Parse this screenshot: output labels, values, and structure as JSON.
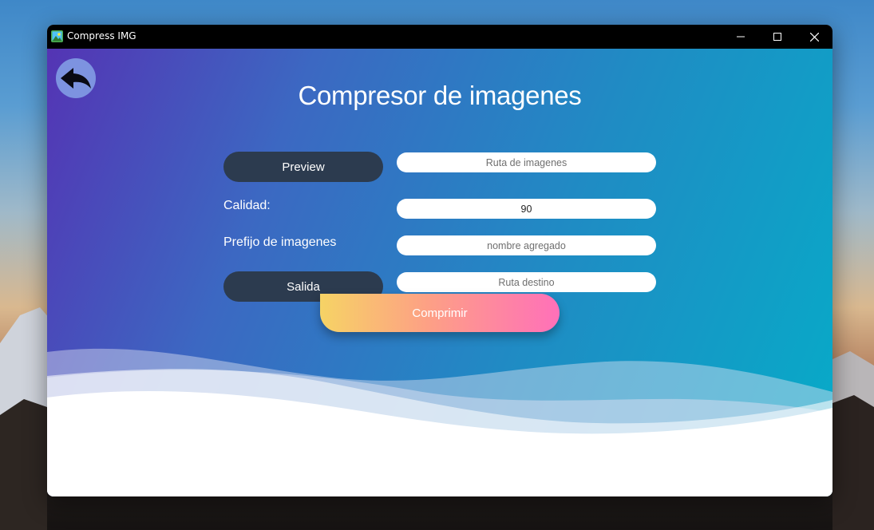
{
  "window": {
    "title": "Compress IMG",
    "icon": "image-icon",
    "controls": {
      "minimize": "minimize-icon",
      "maximize": "maximize-icon",
      "close": "close-icon"
    }
  },
  "app": {
    "back_icon": "back-arrow-icon",
    "heading": "Compresor de imagenes",
    "preview_button": "Preview",
    "images_path": {
      "value": "",
      "placeholder": "Ruta de imagenes"
    },
    "quality_label": "Calidad:",
    "quality": {
      "value": "90",
      "placeholder": ""
    },
    "prefix_label": "Prefijo de imagenes",
    "prefix": {
      "value": "",
      "placeholder": "nombre agregado"
    },
    "output_button": "Salida",
    "output_path": {
      "value": "",
      "placeholder": "Ruta destino"
    },
    "compress_button": "Comprimir"
  },
  "colors": {
    "dark_button": "#2c3b4f",
    "gradient_start": "#5434b4",
    "gradient_end": "#06acc8",
    "compress_gradient": [
      "#f6d365",
      "#fda085",
      "#ff70b9"
    ]
  }
}
